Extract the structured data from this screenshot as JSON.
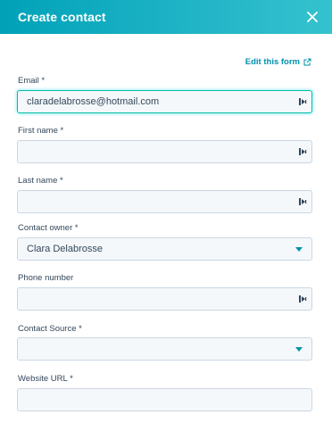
{
  "header": {
    "title": "Create contact"
  },
  "edit_link": {
    "label": "Edit this form"
  },
  "fields": {
    "email": {
      "label": "Email *",
      "value": "claradelabrosse@hotmail.com"
    },
    "first_name": {
      "label": "First name *",
      "value": ""
    },
    "last_name": {
      "label": "Last name *",
      "value": ""
    },
    "contact_owner": {
      "label": "Contact owner *",
      "value": "Clara Delabrosse"
    },
    "phone": {
      "label": "Phone number",
      "value": ""
    },
    "contact_source": {
      "label": "Contact Source *",
      "value": ""
    },
    "website": {
      "label": "Website URL *",
      "value": ""
    }
  },
  "colors": {
    "header_start": "#00a2b8",
    "header_end": "#35c2ce",
    "link": "#0091ae",
    "focus_border": "#00bda5"
  },
  "icons": {
    "close": "close-icon",
    "external": "external-link-icon",
    "autofill": "autofill-key-icon",
    "dropdown": "chevron-down-icon"
  }
}
